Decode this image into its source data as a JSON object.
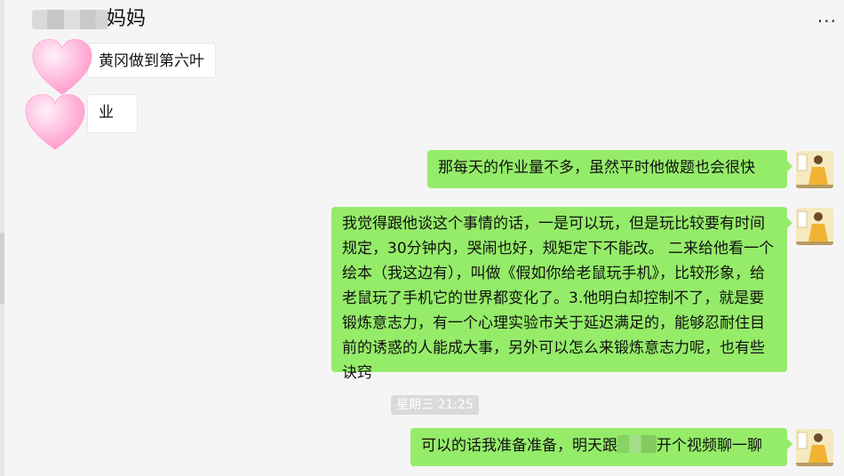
{
  "header": {
    "title_suffix": "妈妈",
    "more_label": "..."
  },
  "messages": {
    "in_1": "黄冈做到第六叶",
    "in_2": "业",
    "out_1": "那每天的作业量不多，虽然平时他做题也会很快",
    "out_2": "我觉得跟他谈这个事情的话，一是可以玩，但是玩比较要有时间规定，30分钟内，哭闹也好，规矩定下不能改。 二来给他看一个绘本（我这边有），叫做《假如你给老鼠玩手机》，比较形象，给老鼠玩了手机它的世界都变化了。3.他明白却控制不了，就是要锻炼意志力，有一个心理实验市关于延迟满足的，能够忍耐住目前的诱惑的人能成大事，另外可以怎么来锻炼意志力呢，也有些诀窍",
    "timestamp": "星期三 21:25",
    "out_3_part1": "可以的话我准备准备，明天跟",
    "out_3_part2": "开个视频聊一聊"
  },
  "colors": {
    "outgoing_bubble": "#95ec69",
    "incoming_bubble": "#ffffff",
    "background": "#f5f5f5",
    "heart": "#ffb6d9"
  },
  "icons": {
    "sticker": "heart-sticker-icon",
    "avatar": "girl-avatar"
  }
}
